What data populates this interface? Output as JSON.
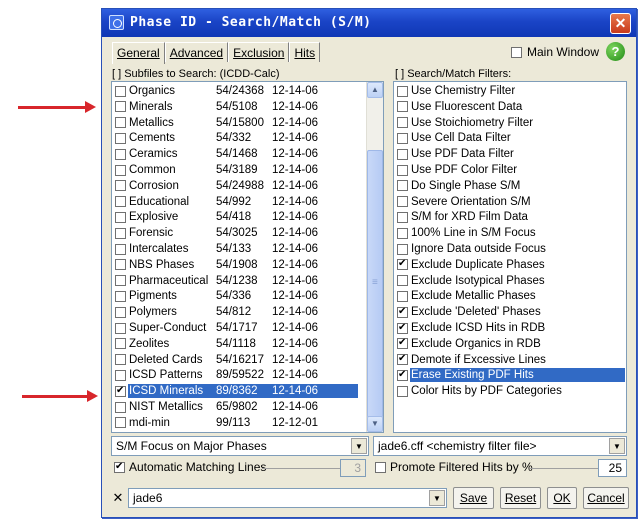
{
  "window": {
    "title": "Phase ID - Search/Match (S/M)",
    "close_glyph": "✕"
  },
  "tabs": [
    {
      "label": "General",
      "active": true
    },
    {
      "label": "Advanced",
      "active": false
    },
    {
      "label": "Exclusion",
      "active": false
    },
    {
      "label": "Hits",
      "active": false
    }
  ],
  "main_window": {
    "label": "Main Window",
    "checked": false
  },
  "help": {
    "glyph": "?"
  },
  "subfiles": {
    "label": "[ ] Subfiles to Search: (ICDD-Calc)",
    "rows": [
      {
        "name": "Organics",
        "count": "54/24368",
        "date": "12-14-06",
        "checked": false,
        "selected": false
      },
      {
        "name": "Minerals",
        "count": "54/5108",
        "date": "12-14-06",
        "checked": false,
        "selected": false
      },
      {
        "name": "Metallics",
        "count": "54/15800",
        "date": "12-14-06",
        "checked": false,
        "selected": false
      },
      {
        "name": "Cements",
        "count": "54/332",
        "date": "12-14-06",
        "checked": false,
        "selected": false
      },
      {
        "name": "Ceramics",
        "count": "54/1468",
        "date": "12-14-06",
        "checked": false,
        "selected": false
      },
      {
        "name": "Common",
        "count": "54/3189",
        "date": "12-14-06",
        "checked": false,
        "selected": false
      },
      {
        "name": "Corrosion",
        "count": "54/24988",
        "date": "12-14-06",
        "checked": false,
        "selected": false
      },
      {
        "name": "Educational",
        "count": "54/992",
        "date": "12-14-06",
        "checked": false,
        "selected": false
      },
      {
        "name": "Explosive",
        "count": "54/418",
        "date": "12-14-06",
        "checked": false,
        "selected": false
      },
      {
        "name": "Forensic",
        "count": "54/3025",
        "date": "12-14-06",
        "checked": false,
        "selected": false
      },
      {
        "name": "Intercalates",
        "count": "54/133",
        "date": "12-14-06",
        "checked": false,
        "selected": false
      },
      {
        "name": "NBS Phases",
        "count": "54/1908",
        "date": "12-14-06",
        "checked": false,
        "selected": false
      },
      {
        "name": "Pharmaceutical",
        "count": "54/1238",
        "date": "12-14-06",
        "checked": false,
        "selected": false
      },
      {
        "name": "Pigments",
        "count": "54/336",
        "date": "12-14-06",
        "checked": false,
        "selected": false
      },
      {
        "name": "Polymers",
        "count": "54/812",
        "date": "12-14-06",
        "checked": false,
        "selected": false
      },
      {
        "name": "Super-Conduct",
        "count": "54/1717",
        "date": "12-14-06",
        "checked": false,
        "selected": false
      },
      {
        "name": "Zeolites",
        "count": "54/1118",
        "date": "12-14-06",
        "checked": false,
        "selected": false
      },
      {
        "name": "Deleted Cards",
        "count": "54/16217",
        "date": "12-14-06",
        "checked": false,
        "selected": false
      },
      {
        "name": "ICSD Patterns",
        "count": "89/59522",
        "date": "12-14-06",
        "checked": false,
        "selected": false
      },
      {
        "name": "ICSD Minerals",
        "count": "89/8362",
        "date": "12-14-06",
        "checked": true,
        "selected": true
      },
      {
        "name": "NIST Metallics",
        "count": "65/9802",
        "date": "12-14-06",
        "checked": false,
        "selected": false
      },
      {
        "name": "mdi-min",
        "count": "99/113",
        "date": "12-12-01",
        "checked": false,
        "selected": false
      }
    ],
    "scroll_up": "▲",
    "scroll_down": "▼"
  },
  "filters": {
    "label": "[ ] Search/Match Filters:",
    "rows": [
      {
        "label": "Use Chemistry Filter",
        "checked": false,
        "selected": false
      },
      {
        "label": "Use Fluorescent Data",
        "checked": false,
        "selected": false
      },
      {
        "label": "Use Stoichiometry Filter",
        "checked": false,
        "selected": false
      },
      {
        "label": "Use Cell Data Filter",
        "checked": false,
        "selected": false
      },
      {
        "label": "Use PDF Data Filter",
        "checked": false,
        "selected": false
      },
      {
        "label": "Use PDF Color Filter",
        "checked": false,
        "selected": false
      },
      {
        "label": "Do Single Phase S/M",
        "checked": false,
        "selected": false
      },
      {
        "label": "Severe Orientation S/M",
        "checked": false,
        "selected": false
      },
      {
        "label": "S/M for XRD Film Data",
        "checked": false,
        "selected": false
      },
      {
        "label": "100% Line in S/M Focus",
        "checked": false,
        "selected": false
      },
      {
        "label": "Ignore Data outside Focus",
        "checked": false,
        "selected": false
      },
      {
        "label": "Exclude Duplicate Phases",
        "checked": true,
        "selected": false
      },
      {
        "label": "Exclude Isotypical Phases",
        "checked": false,
        "selected": false
      },
      {
        "label": "Exclude Metallic Phases",
        "checked": false,
        "selected": false
      },
      {
        "label": "Exclude 'Deleted' Phases",
        "checked": true,
        "selected": false
      },
      {
        "label": "Exclude ICSD Hits in RDB",
        "checked": true,
        "selected": false
      },
      {
        "label": "Exclude Organics in RDB",
        "checked": true,
        "selected": false
      },
      {
        "label": "Demote if Excessive Lines",
        "checked": true,
        "selected": false
      },
      {
        "label": "Erase Existing PDF Hits",
        "checked": true,
        "selected": true
      },
      {
        "label": "Color Hits by PDF Categories",
        "checked": false,
        "selected": false
      }
    ]
  },
  "focus_combo": {
    "value": "S/M Focus on Major Phases",
    "drop": "▼"
  },
  "filter_file_combo": {
    "value": "jade6.cff <chemistry filter file>",
    "drop": "▼"
  },
  "auto_lines": {
    "label": "Automatic Matching Lines",
    "checked": true,
    "value": "3"
  },
  "promote": {
    "label": "Promote Filtered Hits by %",
    "checked": false,
    "value": "25"
  },
  "bottom": {
    "x_glyph": "✕",
    "profile_value": "jade6",
    "drop": "▼",
    "save": "Save",
    "reset": "Reset",
    "ok": "OK",
    "cancel": "Cancel"
  },
  "colors": {
    "arrow": "#d8262b",
    "selection": "#316ac5",
    "title": "#1a44c6"
  }
}
